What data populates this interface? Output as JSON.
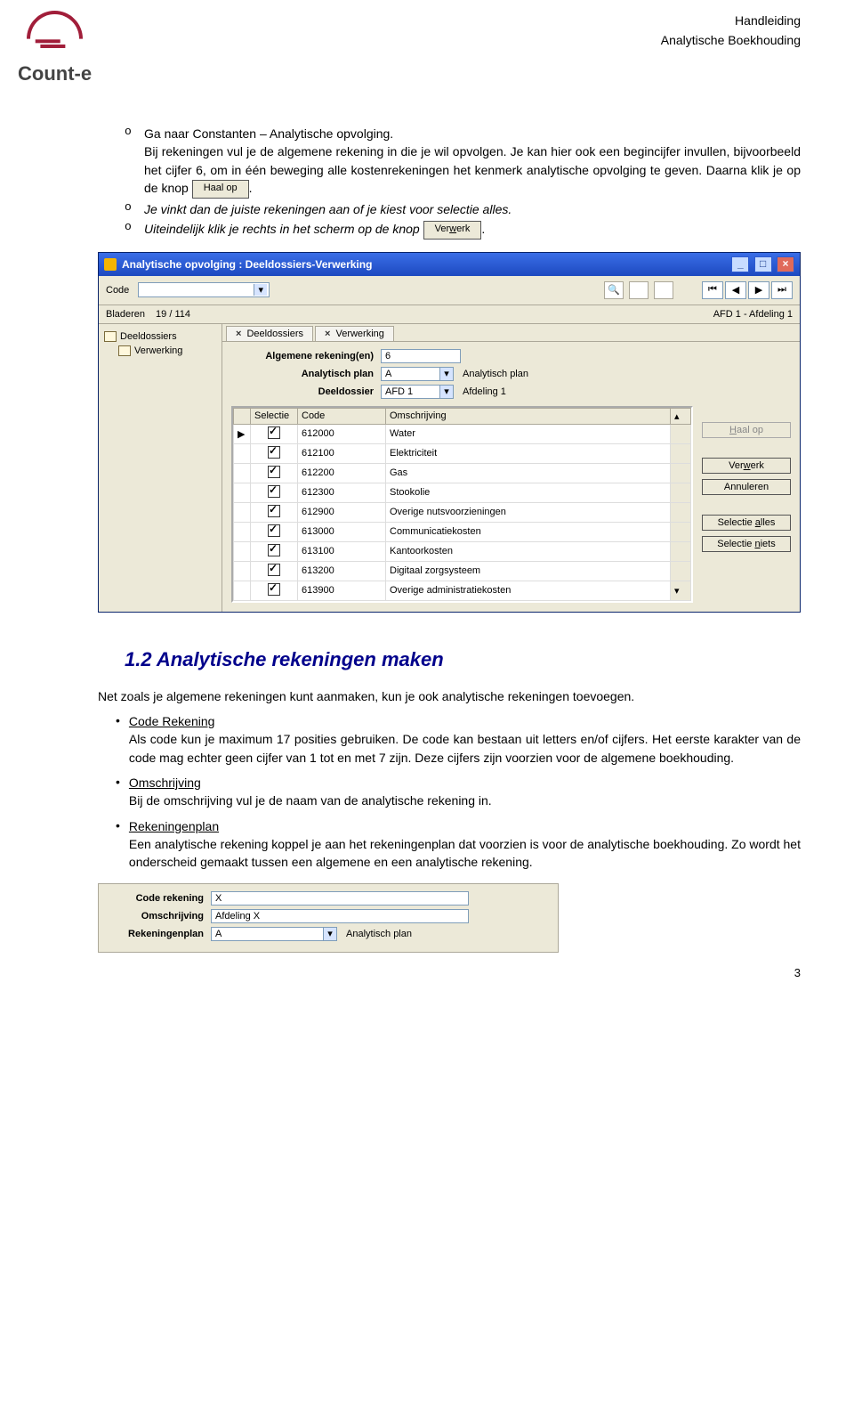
{
  "header": {
    "brand": "Count-e",
    "right1": "Handleiding",
    "right2": "Analytische Boekhouding"
  },
  "intro": {
    "o1": "o",
    "p1_a": "Ga naar Constanten – Analytische opvolging.",
    "p1_b": "Bij rekeningen vul je de algemene rekening in die je wil opvolgen. Je kan hier ook een begincijfer invullen, bijvoorbeeld het cijfer 6, om in één beweging alle kostenrekeningen het kenmerk analytische opvolging te geven. Daarna klik je op de knop",
    "btn_haal": "Haal op",
    "o2": "o",
    "p2": "Je vinkt dan de juiste rekeningen aan of je kiest voor selectie alles.",
    "o3": "o",
    "p3": "Uiteindelijk klik je rechts in het scherm op de knop",
    "btn_verwerk": "Verwerk",
    "btn_verwerk_u": "w"
  },
  "win": {
    "title": "Analytische opvolging : Deeldossiers-Verwerking",
    "min": "_",
    "max": "□",
    "close": "×",
    "code_label": "Code",
    "search_glyph": "🔍",
    "nav": [
      "⏮",
      "◀",
      "▶",
      "⏭"
    ],
    "info_left_label": "Bladeren",
    "info_left_val": "19 / 114",
    "info_right": "AFD 1 - Afdeling 1",
    "tree": [
      {
        "label": "Deeldossiers",
        "child": false
      },
      {
        "label": "Verwerking",
        "child": true
      }
    ],
    "tabs": [
      "Deeldossiers",
      "Verwerking"
    ],
    "form": {
      "alg_label": "Algemene rekening(en)",
      "alg_val": "6",
      "plan_label": "Analytisch plan",
      "plan_val": "A",
      "plan_text": "Analytisch plan",
      "deel_label": "Deeldossier",
      "deel_val": "AFD 1",
      "deel_text": "Afdeling 1"
    },
    "columns": {
      "sel": "Selectie",
      "code": "Code",
      "oms": "Omschrijving"
    },
    "rows": [
      {
        "code": "612000",
        "oms": "Water"
      },
      {
        "code": "612100",
        "oms": "Elektriciteit"
      },
      {
        "code": "612200",
        "oms": "Gas"
      },
      {
        "code": "612300",
        "oms": "Stookolie"
      },
      {
        "code": "612900",
        "oms": "Overige nutsvoorzieningen"
      },
      {
        "code": "613000",
        "oms": "Communicatiekosten"
      },
      {
        "code": "613100",
        "oms": "Kantoorkosten"
      },
      {
        "code": "613200",
        "oms": "Digitaal zorgsysteem"
      },
      {
        "code": "613900",
        "oms": "Overige administratiekosten"
      }
    ],
    "btns": {
      "haal": "Haal op",
      "haal_u": "H",
      "verw": "Verwerk",
      "verw_u": "w",
      "ann": "Annuleren",
      "sel_a": "Selectie alles",
      "sel_a_u": "a",
      "sel_n": "Selectie niets",
      "sel_n_u": "n"
    }
  },
  "section": {
    "heading": "1.2 Analytische rekeningen maken",
    "intro": "Net zoals je algemene rekeningen kunt aanmaken, kun je ook analytische rekeningen toevoegen.",
    "b1_title": "Code Rekening",
    "b1_body": "Als code kun je maximum 17 posities gebruiken. De code kan bestaan uit letters en/of cijfers. Het eerste karakter van de code mag echter geen cijfer van 1 tot en met 7 zijn. Deze cijfers zijn voorzien voor de algemene boekhouding.",
    "b2_title": "Omschrijving",
    "b2_body": "Bij de omschrijving vul je de naam van de analytische rekening in.",
    "b3_title": "Rekeningenplan",
    "b3_body": "Een analytische rekening koppel je aan het rekeningenplan dat voorzien is voor de analytische boekhouding. Zo wordt het onderscheid gemaakt tussen een algemene en een analytische rekening."
  },
  "sf": {
    "code_label": "Code rekening",
    "code_val": "X",
    "oms_label": "Omschrijving",
    "oms_val": "Afdeling X",
    "plan_label": "Rekeningenplan",
    "plan_val": "A",
    "plan_text": "Analytisch plan"
  },
  "page_num": "3"
}
